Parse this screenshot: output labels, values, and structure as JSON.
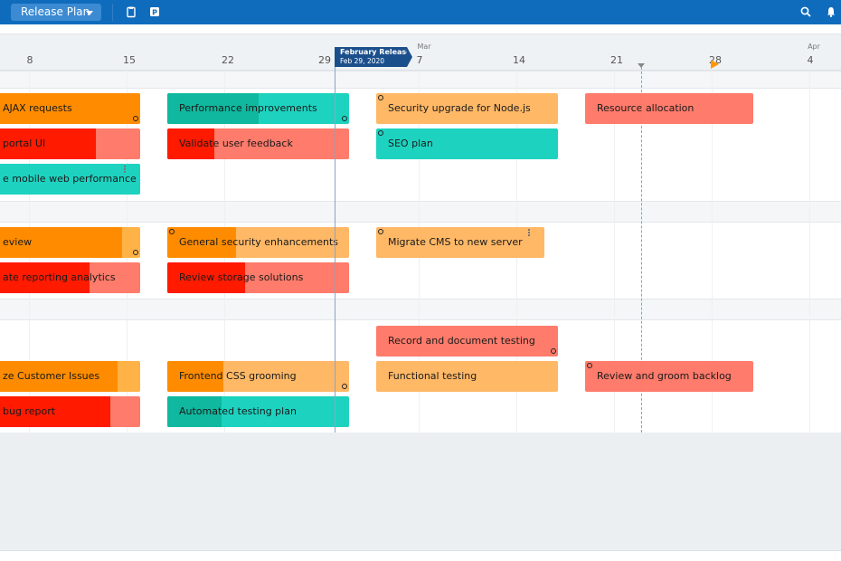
{
  "toolbar": {
    "view_label": "Release Plan",
    "icons": [
      "clipboard-icon",
      "p-badge-icon",
      "search-icon",
      "bell-icon"
    ]
  },
  "timeline": {
    "ticks": [
      "8",
      "15",
      "22",
      "29",
      "7",
      "14",
      "21",
      "28",
      "4"
    ],
    "months": [
      "Mar",
      "Apr"
    ],
    "release": {
      "name": "February Release",
      "date": "Feb 29, 2020"
    }
  },
  "bars": [
    {
      "label": "AJAX requests",
      "color": "#ffb347",
      "progress_color": "#ff8c00",
      "progress": 1.0
    },
    {
      "label": "portal UI",
      "color": "#ff7b6b",
      "progress_color": "#ff1a00",
      "progress": 0.7
    },
    {
      "label": "e mobile web performance",
      "color": "#1dd3c0",
      "progress_color": "#1dd3c0",
      "progress": 0.0
    },
    {
      "label": "Performance improvements",
      "color": "#1dd3c0",
      "progress_color": "#0fb89e",
      "progress": 0.5
    },
    {
      "label": "Validate user feedback",
      "color": "#ff7b6b",
      "progress_color": "#ff1a00",
      "progress": 0.26
    },
    {
      "label": "Security upgrade for Node.js",
      "color": "#ffb866",
      "progress_color": "#ffb866",
      "progress": 0.0
    },
    {
      "label": "SEO plan",
      "color": "#1dd3c0",
      "progress_color": "#1dd3c0",
      "progress": 0.0
    },
    {
      "label": "Resource allocation",
      "color": "#ff7b6b",
      "progress_color": "#ff7b6b",
      "progress": 0.0
    },
    {
      "label": "eview",
      "color": "#ffb347",
      "progress_color": "#ff8c00",
      "progress": 0.88
    },
    {
      "label": "ate reporting analytics",
      "color": "#ff7b6b",
      "progress_color": "#ff1a00",
      "progress": 0.66
    },
    {
      "label": "General security enhancements",
      "color": "#ffb866",
      "progress_color": "#ff8c00",
      "progress": 0.38
    },
    {
      "label": "Review storage solutions",
      "color": "#ff7b6b",
      "progress_color": "#ff1a00",
      "progress": 0.43
    },
    {
      "label": "Migrate CMS to new server",
      "color": "#ffb866",
      "progress_color": "#ffb866",
      "progress": 0.0
    },
    {
      "label": "Record and document testing",
      "color": "#ff7b6b",
      "progress_color": "#ff7b6b",
      "progress": 0.0
    },
    {
      "label": "ze Customer Issues",
      "color": "#ffb347",
      "progress_color": "#ff8c00",
      "progress": 0.85
    },
    {
      "label": "bug report",
      "color": "#ff7b6b",
      "progress_color": "#ff1a00",
      "progress": 0.8
    },
    {
      "label": "Frontend CSS grooming",
      "color": "#ffb866",
      "progress_color": "#ff8c00",
      "progress": 0.31
    },
    {
      "label": "Automated testing plan",
      "color": "#1dd3c0",
      "progress_color": "#0fb89e",
      "progress": 0.3
    },
    {
      "label": "Functional testing",
      "color": "#ffb866",
      "progress_color": "#ffb866",
      "progress": 0.0
    },
    {
      "label": "Review and groom backlog",
      "color": "#ff7b6b",
      "progress_color": "#ff7b6b",
      "progress": 0.0
    }
  ]
}
